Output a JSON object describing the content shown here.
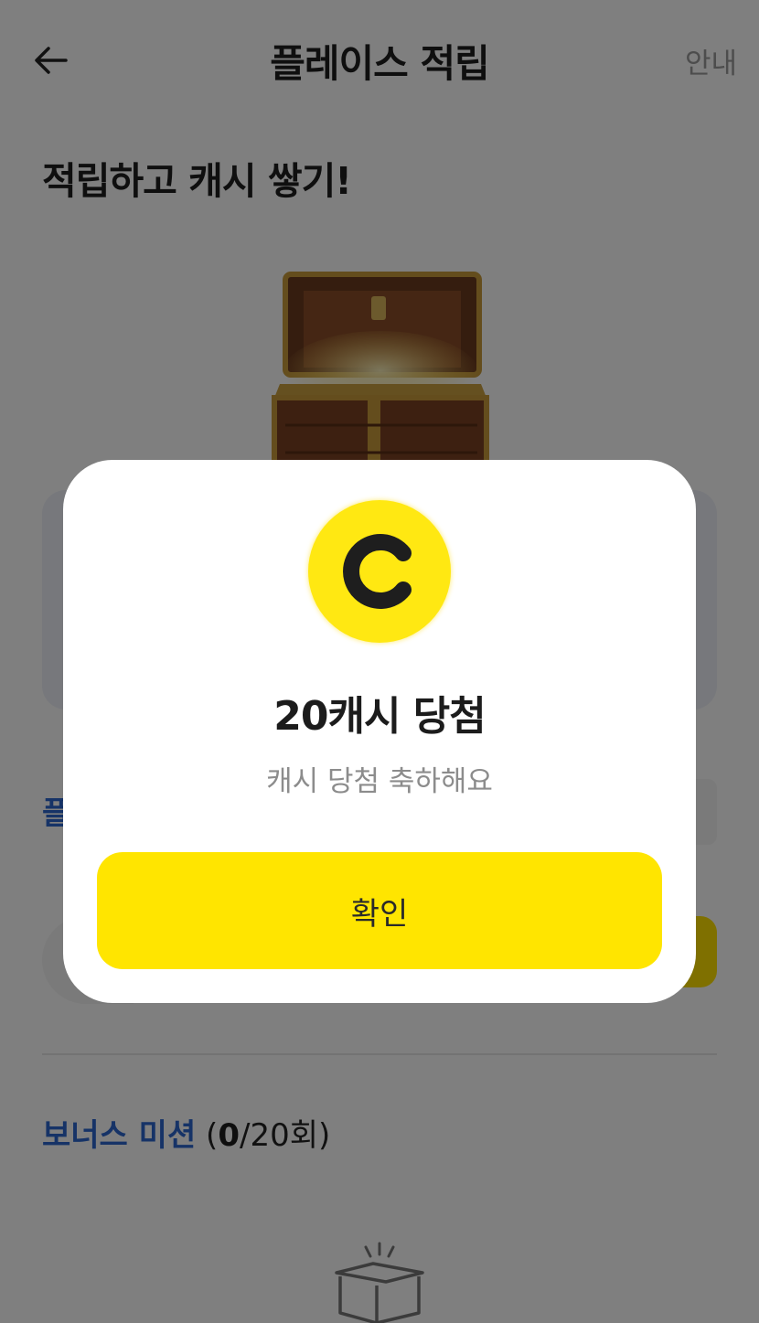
{
  "header": {
    "title": "플레이스 적립",
    "guide_label": "안내",
    "back_icon": "arrow-left-icon"
  },
  "main": {
    "headline": "적립하고 캐시 쌓기!",
    "place_label": "플",
    "bonus": {
      "label": "보너스 미션",
      "open": " (",
      "count": "0",
      "total": "/20회)"
    }
  },
  "modal": {
    "coin_icon": "cash-coin-icon",
    "coin_color": "#ffe812",
    "title": "20캐시 당첨",
    "subtitle": "캐시 당첨 축하해요",
    "confirm_label": "확인",
    "confirm_color": "#ffe500"
  },
  "colors": {
    "accent_blue": "#2c66cf",
    "yellow": "#ffe500"
  }
}
